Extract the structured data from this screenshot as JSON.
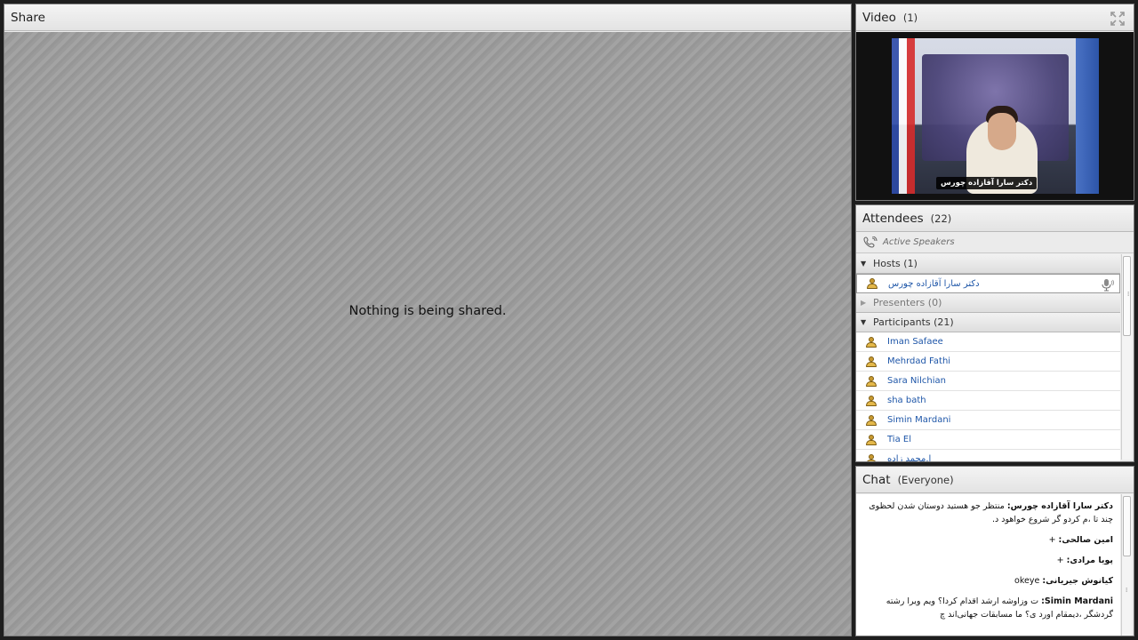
{
  "share": {
    "title": "Share",
    "message": "Nothing is being shared."
  },
  "video": {
    "title": "Video",
    "count": "(1)",
    "caption": "دکتر سارا آقازاده چورس"
  },
  "attendees": {
    "title": "Attendees",
    "count": "(22)",
    "active_speakers": "Active Speakers",
    "hosts_label": "Hosts (1)",
    "host_name": "دکتر سارا آقازاده چورس",
    "presenters_label": "Presenters (0)",
    "participants_label": "Participants (21)",
    "participants": [
      "Iman Safaee",
      "Mehrdad Fathi",
      "Sara Nilchian",
      "sha bath",
      "Simin Mardani",
      "Tia El",
      "ا.محمد زاده"
    ]
  },
  "chat": {
    "title": "Chat",
    "scope": "(Everyone)",
    "messages": [
      {
        "who": "دکتر سارا آقازاده چورس:",
        "text": " منتظر جو هستید دوستان شدن لحظوی چند تا ،م کردو گر شروع خواهود د."
      },
      {
        "who": "امین صالحی:",
        "text": " +"
      },
      {
        "who": "پویا مرادی:",
        "text": " +"
      },
      {
        "who": "کیانوش جیریانی:",
        "text": " okeye"
      },
      {
        "who": "Simin Mardani:",
        "text": " ت وزاوشه ارشد اقدام کردا؟ ویم ویرا رشته گردشگر ،دیمقام اورد ی؟ ما مسابقات جهانی‌اند چ"
      }
    ]
  }
}
